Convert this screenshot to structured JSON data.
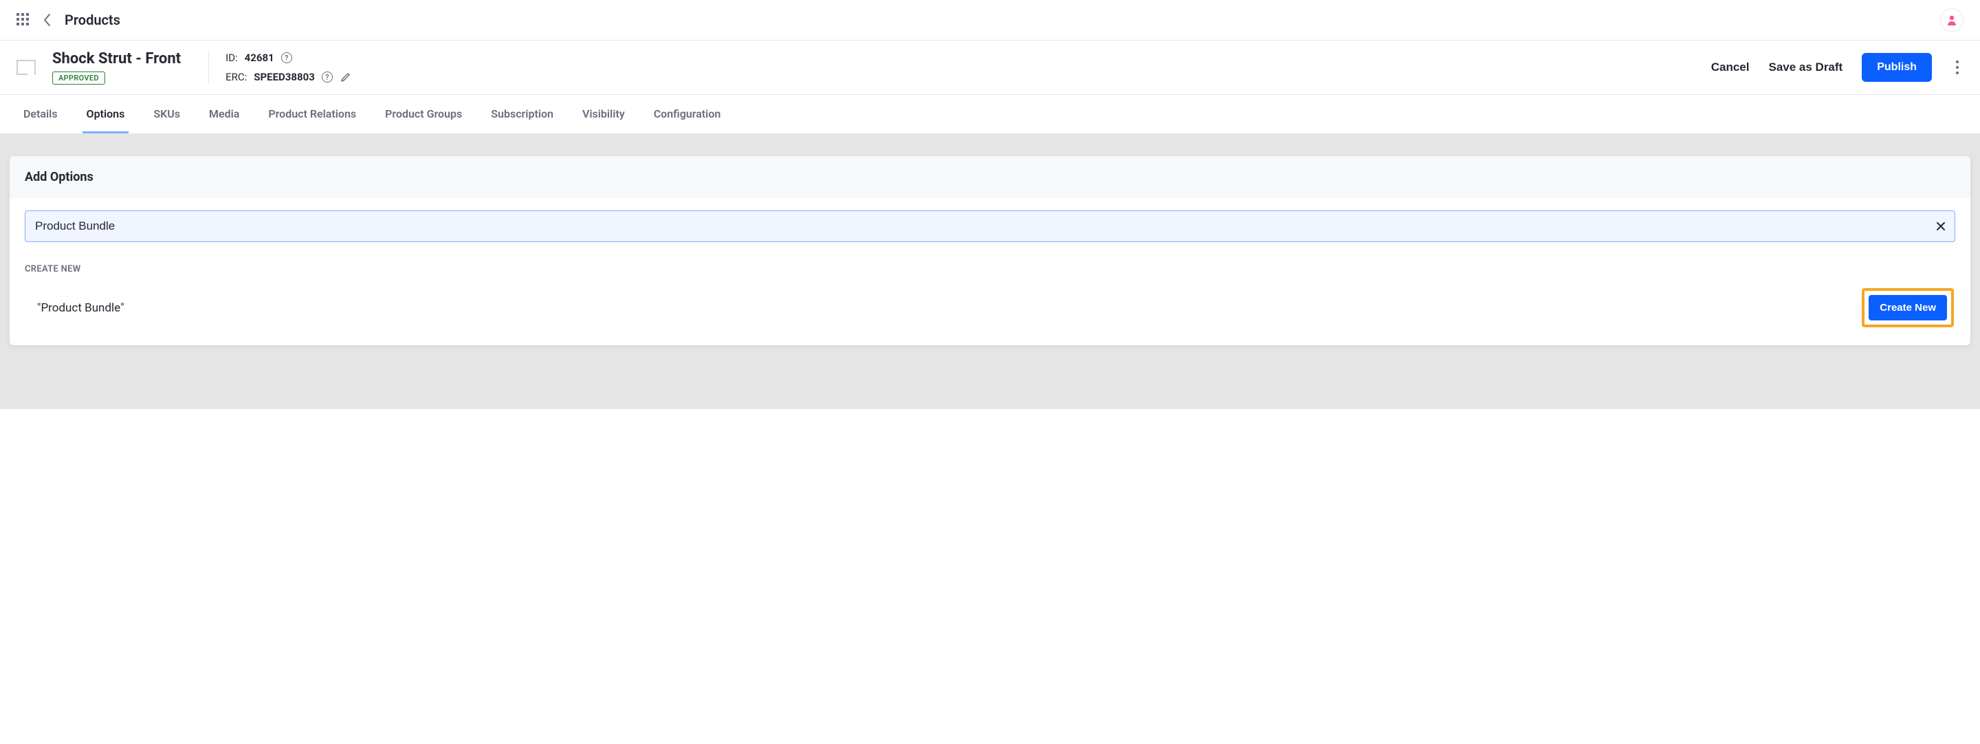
{
  "topbar": {
    "breadcrumb": "Products"
  },
  "header": {
    "title": "Shock Strut - Front",
    "status": "APPROVED",
    "id_label": "ID:",
    "id_value": "42681",
    "erc_label": "ERC:",
    "erc_value": "SPEED38803"
  },
  "actions": {
    "cancel": "Cancel",
    "draft": "Save as Draft",
    "publish": "Publish"
  },
  "tabs": [
    {
      "label": "Details",
      "active": false
    },
    {
      "label": "Options",
      "active": true
    },
    {
      "label": "SKUs",
      "active": false
    },
    {
      "label": "Media",
      "active": false
    },
    {
      "label": "Product Relations",
      "active": false
    },
    {
      "label": "Product Groups",
      "active": false
    },
    {
      "label": "Subscription",
      "active": false
    },
    {
      "label": "Visibility",
      "active": false
    },
    {
      "label": "Configuration",
      "active": false
    }
  ],
  "panel": {
    "title": "Add Options",
    "search_value": "Product Bundle",
    "section_label": "CREATE NEW",
    "result_text": "\"Product Bundle\"",
    "create_label": "Create New"
  },
  "colors": {
    "primary": "#0b5fff",
    "accent_highlight": "#f5a623",
    "approved": "#287d3c",
    "avatar": "#ff4f9a"
  }
}
